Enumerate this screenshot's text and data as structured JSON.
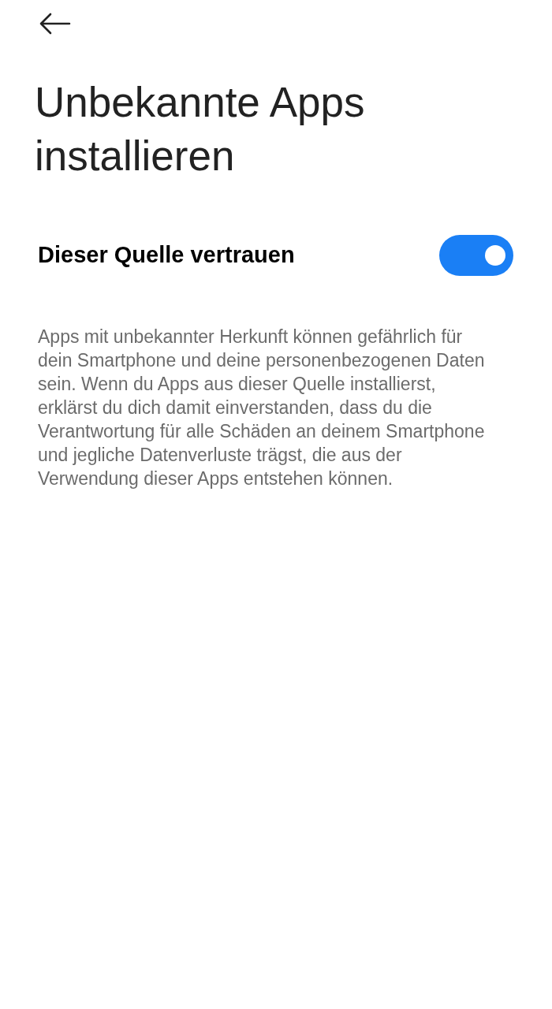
{
  "title": "Unbekannte Apps installieren",
  "setting": {
    "label": "Dieser Quelle vertrauen",
    "on": true
  },
  "description": "Apps mit unbekannter Herkunft können gefährlich für dein Smartphone und deine personenbezogenen Daten sein. Wenn du Apps aus dieser Quelle installierst, erklärst du dich damit einverstanden, dass du die Verantwortung für alle Schäden an deinem Smartphone und jegliche Datenverluste trägst, die aus der Verwendung dieser Apps entstehen können."
}
